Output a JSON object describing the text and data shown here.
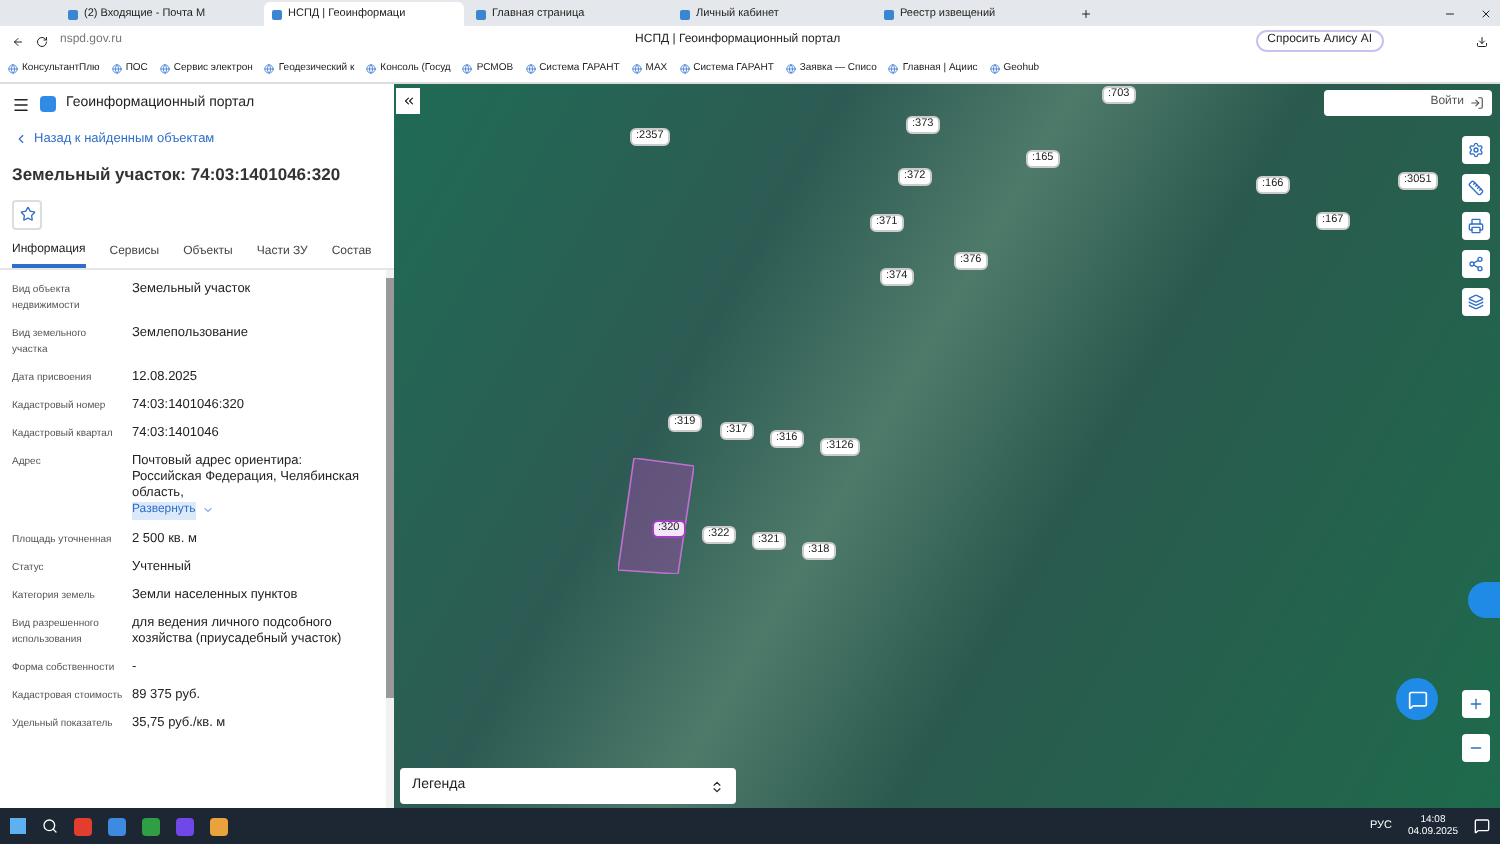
{
  "browser": {
    "tabs": [
      {
        "label": "(2) Входящие - Почта M",
        "selected": false
      },
      {
        "label": "НСПД | Геоинформаци",
        "selected": true
      },
      {
        "label": "Главная страница",
        "selected": false
      },
      {
        "label": "Личный кабинет",
        "selected": false
      },
      {
        "label": "Реестр извещений",
        "selected": false
      }
    ],
    "address": "nspd.gov.ru",
    "page_title": "НСПД | Геоинформационный портал",
    "alice_button": "Спросить Алису AI",
    "bookmarks": [
      "КонсультантПлю",
      "ПОС",
      "Сервис электрон",
      "Геодезический к",
      "Консоль (Госуд",
      "РСМОВ",
      "Система ГАРАНТ",
      "MAX",
      "Система ГАРАНТ",
      "Заявка — Списо",
      "Главная | Ациис",
      "Geohub"
    ]
  },
  "sidebar": {
    "portal_title": "Геоинформационный портал",
    "back_link": "Назад к найденным объектам",
    "title": "Земельный участок: 74:03:1401046:320",
    "tabs": [
      {
        "label": "Информация",
        "selected": true
      },
      {
        "label": "Сервисы",
        "selected": false
      },
      {
        "label": "Объекты",
        "selected": false
      },
      {
        "label": "Части ЗУ",
        "selected": false
      },
      {
        "label": "Состав",
        "selected": false
      }
    ],
    "fields": [
      {
        "label": "Вид объекта недвижимости",
        "value": "Земельный участок"
      },
      {
        "label": "Вид земельного участка",
        "value": "Землепользование"
      },
      {
        "label": "Дата присвоения",
        "value": "12.08.2025"
      },
      {
        "label": "Кадастровый номер",
        "value": "74:03:1401046:320"
      },
      {
        "label": "Кадастровый квартал",
        "value": "74:03:1401046"
      },
      {
        "label": "Адрес",
        "value": "Почтовый адрес ориентира: Российская Федерация, Челябинская область,",
        "more_link": "Развернуть"
      },
      {
        "label": "Площадь уточненная",
        "value": "2 500 кв. м"
      },
      {
        "label": "Статус",
        "value": "Учтенный"
      },
      {
        "label": "Категория земель",
        "value": "Земли населенных пунктов"
      },
      {
        "label": "Вид разрешенного использования",
        "value": "для ведения личного подсобного хозяйства (приусадебный участок)"
      },
      {
        "label": "Форма собственности",
        "value": "-"
      },
      {
        "label": "Кадастровая стоимость",
        "value": "89 375 руб."
      },
      {
        "label": "Удельный показатель",
        "value": "35,75 руб./кв. м"
      }
    ]
  },
  "map": {
    "login_button": "Войти",
    "legend": "Легенда",
    "parcels": [
      {
        "label": ":2357",
        "selected": false
      },
      {
        "label": ":373",
        "selected": false
      },
      {
        "label": ":165",
        "selected": false
      },
      {
        "label": ":703",
        "selected": false
      },
      {
        "label": ":372",
        "selected": false
      },
      {
        "label": ":166",
        "selected": false
      },
      {
        "label": ":3051",
        "selected": false
      },
      {
        "label": ":371",
        "selected": false
      },
      {
        "label": ":167",
        "selected": false
      },
      {
        "label": ":376",
        "selected": false
      },
      {
        "label": ":374",
        "selected": false
      },
      {
        "label": ":319",
        "selected": false
      },
      {
        "label": ":317",
        "selected": false
      },
      {
        "label": ":316",
        "selected": false
      },
      {
        "label": ":3126",
        "selected": false
      },
      {
        "label": ":320",
        "selected": true
      },
      {
        "label": ":322",
        "selected": false
      },
      {
        "label": ":321",
        "selected": false
      },
      {
        "label": ":318",
        "selected": false
      }
    ]
  },
  "taskbar": {
    "language": "РУС",
    "time": "14:08",
    "date": "04.09.2025"
  }
}
